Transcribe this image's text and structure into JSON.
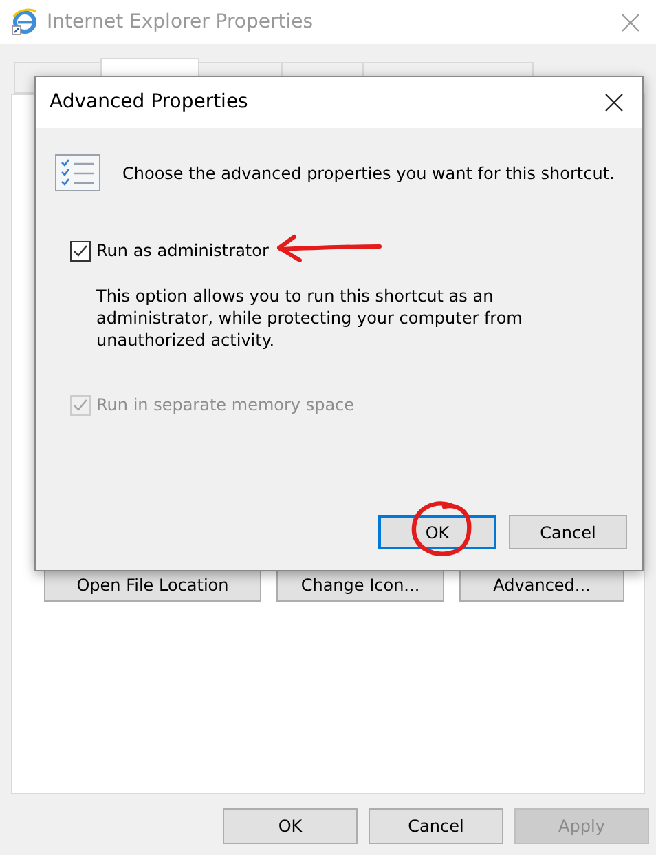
{
  "window": {
    "title": "Internet Explorer Properties"
  },
  "tabs": [
    {
      "selected": false
    },
    {
      "selected": true
    },
    {
      "selected": false
    },
    {
      "selected": false
    },
    {
      "selected": false
    }
  ],
  "panel_buttons": [
    "Open File Location",
    "Change Icon...",
    "Advanced..."
  ],
  "buttons": [
    {
      "label": "OK",
      "disabled": false
    },
    {
      "label": "Cancel",
      "disabled": false
    },
    {
      "label": "Apply",
      "disabled": true
    }
  ],
  "dialog": {
    "title": "Advanced Properties",
    "intro": "Choose the advanced properties you want for this shortcut.",
    "options": [
      {
        "label": "Run as administrator",
        "checked": true,
        "disabled": false,
        "description": "This option allows you to run this shortcut as an administrator, while protecting your computer from unauthorized activity."
      },
      {
        "label": "Run in separate memory space",
        "checked": true,
        "disabled": true
      }
    ],
    "buttons": [
      {
        "label": "OK",
        "default": true
      },
      {
        "label": "Cancel",
        "default": false
      }
    ]
  }
}
